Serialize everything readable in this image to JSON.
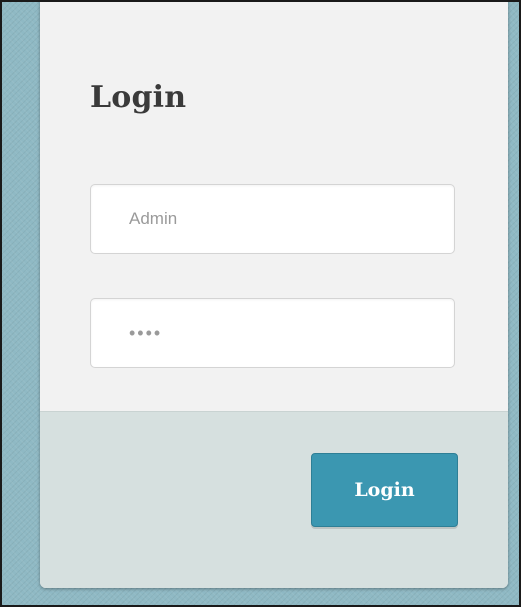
{
  "login_form": {
    "title": "Login",
    "username": {
      "value": "",
      "placeholder": "Admin"
    },
    "password": {
      "value": "",
      "placeholder": "••••"
    },
    "submit_label": "Login"
  },
  "colors": {
    "background": "#8fb9c4",
    "card": "#f2f2f2",
    "footer": "#d6e0df",
    "button": "#3b97b1",
    "title_text": "#3a3a3a"
  }
}
